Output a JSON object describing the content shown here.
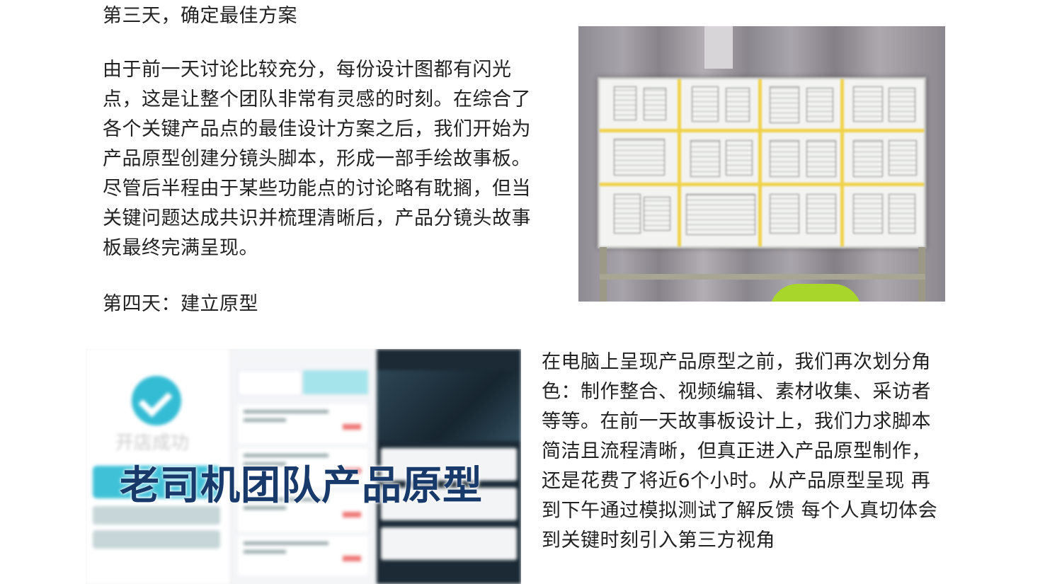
{
  "day3": {
    "heading": "第三天，确定最佳方案",
    "body": "由于前一天讨论比较充分，每份设计图都有闪光点，这是让整个团队非常有灵感的时刻。在综合了各个关键产品点的最佳设计方案之后，我们开始为产品原型创建分镜头脚本，形成一部手绘故事板。尽管后半程由于某些功能点的讨论略有耽搁，但当关键问题达成共识并梳理清晰后，产品分镜头故事板最终完满呈现。"
  },
  "day4": {
    "heading": "第四天：建立原型",
    "body": "在电脑上呈现产品原型之前，我们再次划分角色：制作整合、视频编辑、素材收集、采访者等等。在前一天故事板设计上，我们力求脚本简洁且流程清晰，但真正进入产品原型制作，还是花费了将近6个小时。从产品原型呈现 再到下午通过模拟测试了解反馈 每个人真切体会到关键时刻引入第三方视角"
  },
  "prototype_image": {
    "overlay_title": "老司机团队产品原型",
    "faded_screen_title": "开店成功"
  },
  "colors": {
    "text": "#222222",
    "overlay_title": "#173a6b",
    "accent_cyan": "#3fc1d8",
    "tape_yellow": "#f0d24a",
    "chair_green": "#a8d62a"
  }
}
